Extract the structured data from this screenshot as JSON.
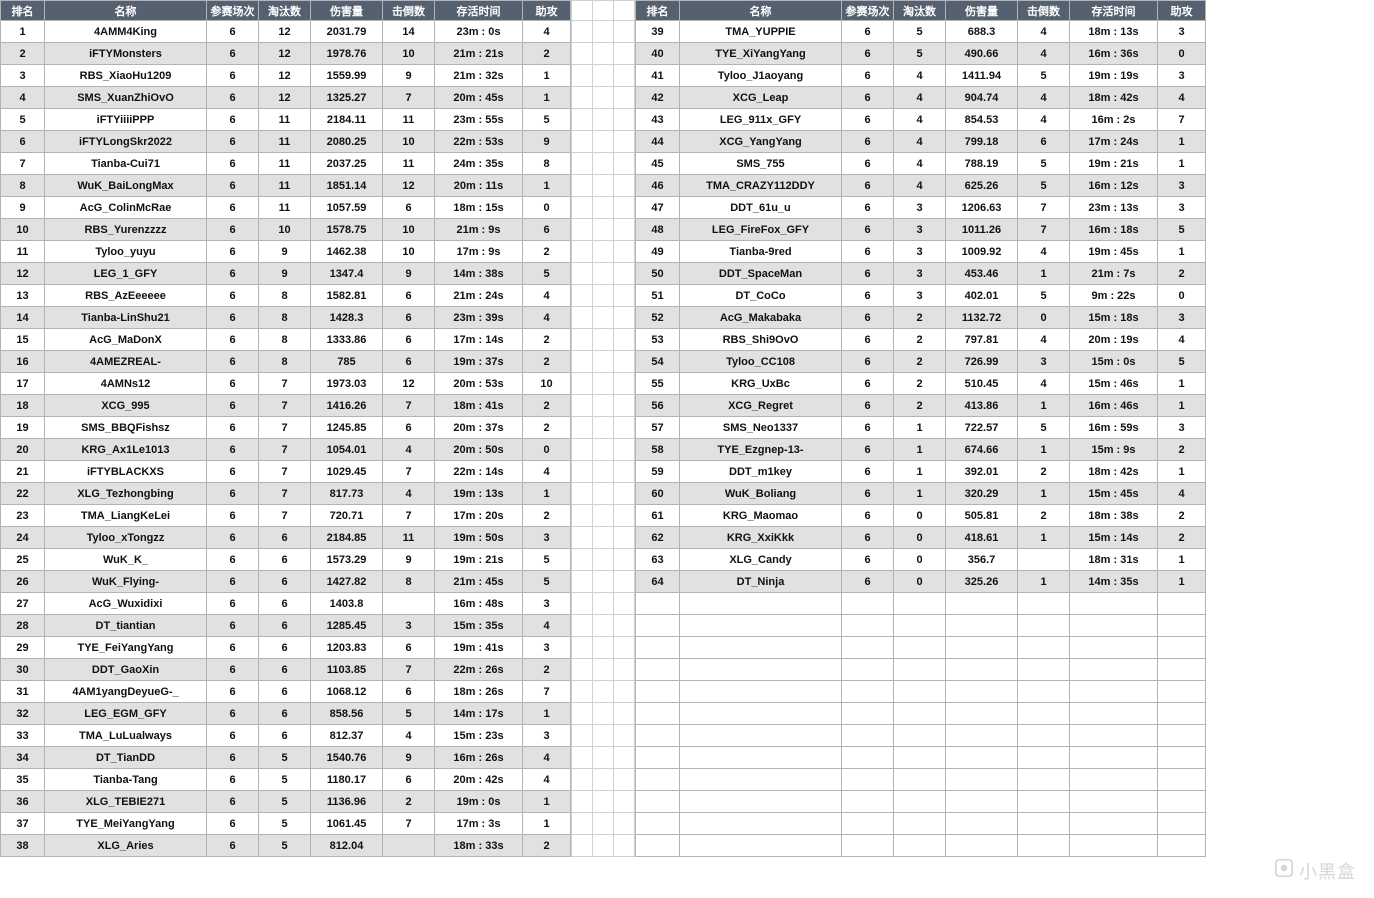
{
  "headers": {
    "rank": "排名",
    "name": "名称",
    "matches": "参赛场次",
    "elims": "淘汰数",
    "damage": "伤害量",
    "knockdowns": "击倒数",
    "survive": "存活时间",
    "assist": "助攻"
  },
  "watermark": "小黑盒",
  "left": [
    {
      "rank": "1",
      "name": "4AMM4King",
      "matches": "6",
      "elims": "12",
      "damage": "2031.79",
      "kd": "14",
      "survive": "23m : 0s",
      "assist": "4"
    },
    {
      "rank": "2",
      "name": "iFTYMonsters",
      "matches": "6",
      "elims": "12",
      "damage": "1978.76",
      "kd": "10",
      "survive": "21m : 21s",
      "assist": "2"
    },
    {
      "rank": "3",
      "name": "RBS_XiaoHu1209",
      "matches": "6",
      "elims": "12",
      "damage": "1559.99",
      "kd": "9",
      "survive": "21m : 32s",
      "assist": "1"
    },
    {
      "rank": "4",
      "name": "SMS_XuanZhiOvO",
      "matches": "6",
      "elims": "12",
      "damage": "1325.27",
      "kd": "7",
      "survive": "20m : 45s",
      "assist": "1"
    },
    {
      "rank": "5",
      "name": "iFTYiiiiPPP",
      "matches": "6",
      "elims": "11",
      "damage": "2184.11",
      "kd": "11",
      "survive": "23m : 55s",
      "assist": "5"
    },
    {
      "rank": "6",
      "name": "iFTYLongSkr2022",
      "matches": "6",
      "elims": "11",
      "damage": "2080.25",
      "kd": "10",
      "survive": "22m : 53s",
      "assist": "9"
    },
    {
      "rank": "7",
      "name": "Tianba-Cui71",
      "matches": "6",
      "elims": "11",
      "damage": "2037.25",
      "kd": "11",
      "survive": "24m : 35s",
      "assist": "8"
    },
    {
      "rank": "8",
      "name": "WuK_BaiLongMax",
      "matches": "6",
      "elims": "11",
      "damage": "1851.14",
      "kd": "12",
      "survive": "20m : 11s",
      "assist": "1"
    },
    {
      "rank": "9",
      "name": "AcG_ColinMcRae",
      "matches": "6",
      "elims": "11",
      "damage": "1057.59",
      "kd": "6",
      "survive": "18m : 15s",
      "assist": "0"
    },
    {
      "rank": "10",
      "name": "RBS_Yurenzzzz",
      "matches": "6",
      "elims": "10",
      "damage": "1578.75",
      "kd": "10",
      "survive": "21m : 9s",
      "assist": "6"
    },
    {
      "rank": "11",
      "name": "Tyloo_yuyu",
      "matches": "6",
      "elims": "9",
      "damage": "1462.38",
      "kd": "10",
      "survive": "17m : 9s",
      "assist": "2"
    },
    {
      "rank": "12",
      "name": "LEG_1_GFY",
      "matches": "6",
      "elims": "9",
      "damage": "1347.4",
      "kd": "9",
      "survive": "14m : 38s",
      "assist": "5"
    },
    {
      "rank": "13",
      "name": "RBS_AzEeeeee",
      "matches": "6",
      "elims": "8",
      "damage": "1582.81",
      "kd": "6",
      "survive": "21m : 24s",
      "assist": "4"
    },
    {
      "rank": "14",
      "name": "Tianba-LinShu21",
      "matches": "6",
      "elims": "8",
      "damage": "1428.3",
      "kd": "6",
      "survive": "23m : 39s",
      "assist": "4"
    },
    {
      "rank": "15",
      "name": "AcG_MaDonX",
      "matches": "6",
      "elims": "8",
      "damage": "1333.86",
      "kd": "6",
      "survive": "17m : 14s",
      "assist": "2"
    },
    {
      "rank": "16",
      "name": "4AMEZREAL-",
      "matches": "6",
      "elims": "8",
      "damage": "785",
      "kd": "6",
      "survive": "19m : 37s",
      "assist": "2"
    },
    {
      "rank": "17",
      "name": "4AMNs12",
      "matches": "6",
      "elims": "7",
      "damage": "1973.03",
      "kd": "12",
      "survive": "20m : 53s",
      "assist": "10"
    },
    {
      "rank": "18",
      "name": "XCG_995",
      "matches": "6",
      "elims": "7",
      "damage": "1416.26",
      "kd": "7",
      "survive": "18m : 41s",
      "assist": "2"
    },
    {
      "rank": "19",
      "name": "SMS_BBQFishsz",
      "matches": "6",
      "elims": "7",
      "damage": "1245.85",
      "kd": "6",
      "survive": "20m : 37s",
      "assist": "2"
    },
    {
      "rank": "20",
      "name": "KRG_Ax1Le1013",
      "matches": "6",
      "elims": "7",
      "damage": "1054.01",
      "kd": "4",
      "survive": "20m : 50s",
      "assist": "0"
    },
    {
      "rank": "21",
      "name": "iFTYBLACKXS",
      "matches": "6",
      "elims": "7",
      "damage": "1029.45",
      "kd": "7",
      "survive": "22m : 14s",
      "assist": "4"
    },
    {
      "rank": "22",
      "name": "XLG_Tezhongbing",
      "matches": "6",
      "elims": "7",
      "damage": "817.73",
      "kd": "4",
      "survive": "19m : 13s",
      "assist": "1"
    },
    {
      "rank": "23",
      "name": "TMA_LiangKeLei",
      "matches": "6",
      "elims": "7",
      "damage": "720.71",
      "kd": "7",
      "survive": "17m : 20s",
      "assist": "2"
    },
    {
      "rank": "24",
      "name": "Tyloo_xTongzz",
      "matches": "6",
      "elims": "6",
      "damage": "2184.85",
      "kd": "11",
      "survive": "19m : 50s",
      "assist": "3"
    },
    {
      "rank": "25",
      "name": "WuK_K_",
      "matches": "6",
      "elims": "6",
      "damage": "1573.29",
      "kd": "9",
      "survive": "19m : 21s",
      "assist": "5"
    },
    {
      "rank": "26",
      "name": "WuK_Flying-",
      "matches": "6",
      "elims": "6",
      "damage": "1427.82",
      "kd": "8",
      "survive": "21m : 45s",
      "assist": "5"
    },
    {
      "rank": "27",
      "name": "AcG_Wuxidixi",
      "matches": "6",
      "elims": "6",
      "damage": "1403.8",
      "kd": "",
      "survive": "16m : 48s",
      "assist": "3"
    },
    {
      "rank": "28",
      "name": "DT_tiantian",
      "matches": "6",
      "elims": "6",
      "damage": "1285.45",
      "kd": "3",
      "survive": "15m : 35s",
      "assist": "4"
    },
    {
      "rank": "29",
      "name": "TYE_FeiYangYang",
      "matches": "6",
      "elims": "6",
      "damage": "1203.83",
      "kd": "6",
      "survive": "19m : 41s",
      "assist": "3"
    },
    {
      "rank": "30",
      "name": "DDT_GaoXin",
      "matches": "6",
      "elims": "6",
      "damage": "1103.85",
      "kd": "7",
      "survive": "22m : 26s",
      "assist": "2"
    },
    {
      "rank": "31",
      "name": "4AM1yangDeyueG-_",
      "matches": "6",
      "elims": "6",
      "damage": "1068.12",
      "kd": "6",
      "survive": "18m : 26s",
      "assist": "7"
    },
    {
      "rank": "32",
      "name": "LEG_EGM_GFY",
      "matches": "6",
      "elims": "6",
      "damage": "858.56",
      "kd": "5",
      "survive": "14m : 17s",
      "assist": "1"
    },
    {
      "rank": "33",
      "name": "TMA_LuLualways",
      "matches": "6",
      "elims": "6",
      "damage": "812.37",
      "kd": "4",
      "survive": "15m : 23s",
      "assist": "3"
    },
    {
      "rank": "34",
      "name": "DT_TianDD",
      "matches": "6",
      "elims": "5",
      "damage": "1540.76",
      "kd": "9",
      "survive": "16m : 26s",
      "assist": "4"
    },
    {
      "rank": "35",
      "name": "Tianba-Tang",
      "matches": "6",
      "elims": "5",
      "damage": "1180.17",
      "kd": "6",
      "survive": "20m : 42s",
      "assist": "4"
    },
    {
      "rank": "36",
      "name": "XLG_TEBIE271",
      "matches": "6",
      "elims": "5",
      "damage": "1136.96",
      "kd": "2",
      "survive": "19m : 0s",
      "assist": "1"
    },
    {
      "rank": "37",
      "name": "TYE_MeiYangYang",
      "matches": "6",
      "elims": "5",
      "damage": "1061.45",
      "kd": "7",
      "survive": "17m : 3s",
      "assist": "1"
    },
    {
      "rank": "38",
      "name": "XLG_Aries",
      "matches": "6",
      "elims": "5",
      "damage": "812.04",
      "kd": "",
      "survive": "18m : 33s",
      "assist": "2"
    }
  ],
  "right": [
    {
      "rank": "39",
      "name": "TMA_YUPPIE",
      "matches": "6",
      "elims": "5",
      "damage": "688.3",
      "kd": "4",
      "survive": "18m : 13s",
      "assist": "3"
    },
    {
      "rank": "40",
      "name": "TYE_XiYangYang",
      "matches": "6",
      "elims": "5",
      "damage": "490.66",
      "kd": "4",
      "survive": "16m : 36s",
      "assist": "0"
    },
    {
      "rank": "41",
      "name": "Tyloo_J1aoyang",
      "matches": "6",
      "elims": "4",
      "damage": "1411.94",
      "kd": "5",
      "survive": "19m : 19s",
      "assist": "3"
    },
    {
      "rank": "42",
      "name": "XCG_Leap",
      "matches": "6",
      "elims": "4",
      "damage": "904.74",
      "kd": "4",
      "survive": "18m : 42s",
      "assist": "4"
    },
    {
      "rank": "43",
      "name": "LEG_911x_GFY",
      "matches": "6",
      "elims": "4",
      "damage": "854.53",
      "kd": "4",
      "survive": "16m : 2s",
      "assist": "7"
    },
    {
      "rank": "44",
      "name": "XCG_YangYang",
      "matches": "6",
      "elims": "4",
      "damage": "799.18",
      "kd": "6",
      "survive": "17m : 24s",
      "assist": "1"
    },
    {
      "rank": "45",
      "name": "SMS_755",
      "matches": "6",
      "elims": "4",
      "damage": "788.19",
      "kd": "5",
      "survive": "19m : 21s",
      "assist": "1"
    },
    {
      "rank": "46",
      "name": "TMA_CRAZY112DDY",
      "matches": "6",
      "elims": "4",
      "damage": "625.26",
      "kd": "5",
      "survive": "16m : 12s",
      "assist": "3"
    },
    {
      "rank": "47",
      "name": "DDT_61u_u",
      "matches": "6",
      "elims": "3",
      "damage": "1206.63",
      "kd": "7",
      "survive": "23m : 13s",
      "assist": "3"
    },
    {
      "rank": "48",
      "name": "LEG_FireFox_GFY",
      "matches": "6",
      "elims": "3",
      "damage": "1011.26",
      "kd": "7",
      "survive": "16m : 18s",
      "assist": "5"
    },
    {
      "rank": "49",
      "name": "Tianba-9red",
      "matches": "6",
      "elims": "3",
      "damage": "1009.92",
      "kd": "4",
      "survive": "19m : 45s",
      "assist": "1"
    },
    {
      "rank": "50",
      "name": "DDT_SpaceMan",
      "matches": "6",
      "elims": "3",
      "damage": "453.46",
      "kd": "1",
      "survive": "21m : 7s",
      "assist": "2"
    },
    {
      "rank": "51",
      "name": "DT_CoCo",
      "matches": "6",
      "elims": "3",
      "damage": "402.01",
      "kd": "5",
      "survive": "9m : 22s",
      "assist": "0"
    },
    {
      "rank": "52",
      "name": "AcG_Makabaka",
      "matches": "6",
      "elims": "2",
      "damage": "1132.72",
      "kd": "0",
      "survive": "15m : 18s",
      "assist": "3"
    },
    {
      "rank": "53",
      "name": "RBS_Shi9OvO",
      "matches": "6",
      "elims": "2",
      "damage": "797.81",
      "kd": "4",
      "survive": "20m : 19s",
      "assist": "4"
    },
    {
      "rank": "54",
      "name": "Tyloo_CC108",
      "matches": "6",
      "elims": "2",
      "damage": "726.99",
      "kd": "3",
      "survive": "15m : 0s",
      "assist": "5"
    },
    {
      "rank": "55",
      "name": "KRG_UxBc",
      "matches": "6",
      "elims": "2",
      "damage": "510.45",
      "kd": "4",
      "survive": "15m : 46s",
      "assist": "1"
    },
    {
      "rank": "56",
      "name": "XCG_Regret",
      "matches": "6",
      "elims": "2",
      "damage": "413.86",
      "kd": "1",
      "survive": "16m : 46s",
      "assist": "1"
    },
    {
      "rank": "57",
      "name": "SMS_Neo1337",
      "matches": "6",
      "elims": "1",
      "damage": "722.57",
      "kd": "5",
      "survive": "16m : 59s",
      "assist": "3"
    },
    {
      "rank": "58",
      "name": "TYE_Ezgnep-13-",
      "matches": "6",
      "elims": "1",
      "damage": "674.66",
      "kd": "1",
      "survive": "15m : 9s",
      "assist": "2"
    },
    {
      "rank": "59",
      "name": "DDT_m1key",
      "matches": "6",
      "elims": "1",
      "damage": "392.01",
      "kd": "2",
      "survive": "18m : 42s",
      "assist": "1"
    },
    {
      "rank": "60",
      "name": "WuK_Boliang",
      "matches": "6",
      "elims": "1",
      "damage": "320.29",
      "kd": "1",
      "survive": "15m : 45s",
      "assist": "4"
    },
    {
      "rank": "61",
      "name": "KRG_Maomao",
      "matches": "6",
      "elims": "0",
      "damage": "505.81",
      "kd": "2",
      "survive": "18m : 38s",
      "assist": "2"
    },
    {
      "rank": "62",
      "name": "KRG_XxiKkk",
      "matches": "6",
      "elims": "0",
      "damage": "418.61",
      "kd": "1",
      "survive": "15m : 14s",
      "assist": "2"
    },
    {
      "rank": "63",
      "name": "XLG_Candy",
      "matches": "6",
      "elims": "0",
      "damage": "356.7",
      "kd": "",
      "survive": "18m : 31s",
      "assist": "1"
    },
    {
      "rank": "64",
      "name": "DT_Ninja",
      "matches": "6",
      "elims": "0",
      "damage": "325.26",
      "kd": "1",
      "survive": "14m : 35s",
      "assist": "1"
    }
  ],
  "right_empty_rows": 12
}
